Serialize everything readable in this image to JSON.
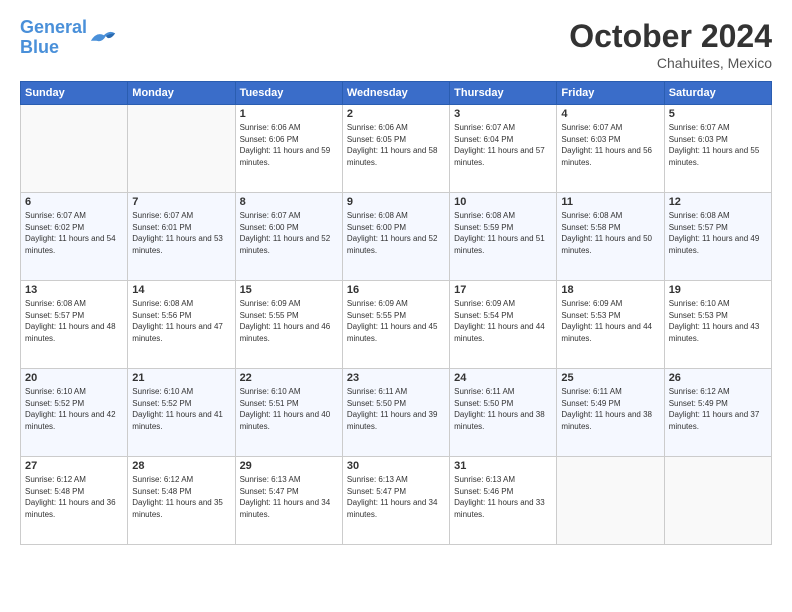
{
  "header": {
    "logo_line1": "General",
    "logo_line2": "Blue",
    "month_title": "October 2024",
    "subtitle": "Chahuites, Mexico"
  },
  "days_of_week": [
    "Sunday",
    "Monday",
    "Tuesday",
    "Wednesday",
    "Thursday",
    "Friday",
    "Saturday"
  ],
  "weeks": [
    [
      {
        "day": "",
        "info": ""
      },
      {
        "day": "",
        "info": ""
      },
      {
        "day": "1",
        "info": "Sunrise: 6:06 AM\nSunset: 6:06 PM\nDaylight: 11 hours and 59 minutes."
      },
      {
        "day": "2",
        "info": "Sunrise: 6:06 AM\nSunset: 6:05 PM\nDaylight: 11 hours and 58 minutes."
      },
      {
        "day": "3",
        "info": "Sunrise: 6:07 AM\nSunset: 6:04 PM\nDaylight: 11 hours and 57 minutes."
      },
      {
        "day": "4",
        "info": "Sunrise: 6:07 AM\nSunset: 6:03 PM\nDaylight: 11 hours and 56 minutes."
      },
      {
        "day": "5",
        "info": "Sunrise: 6:07 AM\nSunset: 6:03 PM\nDaylight: 11 hours and 55 minutes."
      }
    ],
    [
      {
        "day": "6",
        "info": "Sunrise: 6:07 AM\nSunset: 6:02 PM\nDaylight: 11 hours and 54 minutes."
      },
      {
        "day": "7",
        "info": "Sunrise: 6:07 AM\nSunset: 6:01 PM\nDaylight: 11 hours and 53 minutes."
      },
      {
        "day": "8",
        "info": "Sunrise: 6:07 AM\nSunset: 6:00 PM\nDaylight: 11 hours and 52 minutes."
      },
      {
        "day": "9",
        "info": "Sunrise: 6:08 AM\nSunset: 6:00 PM\nDaylight: 11 hours and 52 minutes."
      },
      {
        "day": "10",
        "info": "Sunrise: 6:08 AM\nSunset: 5:59 PM\nDaylight: 11 hours and 51 minutes."
      },
      {
        "day": "11",
        "info": "Sunrise: 6:08 AM\nSunset: 5:58 PM\nDaylight: 11 hours and 50 minutes."
      },
      {
        "day": "12",
        "info": "Sunrise: 6:08 AM\nSunset: 5:57 PM\nDaylight: 11 hours and 49 minutes."
      }
    ],
    [
      {
        "day": "13",
        "info": "Sunrise: 6:08 AM\nSunset: 5:57 PM\nDaylight: 11 hours and 48 minutes."
      },
      {
        "day": "14",
        "info": "Sunrise: 6:08 AM\nSunset: 5:56 PM\nDaylight: 11 hours and 47 minutes."
      },
      {
        "day": "15",
        "info": "Sunrise: 6:09 AM\nSunset: 5:55 PM\nDaylight: 11 hours and 46 minutes."
      },
      {
        "day": "16",
        "info": "Sunrise: 6:09 AM\nSunset: 5:55 PM\nDaylight: 11 hours and 45 minutes."
      },
      {
        "day": "17",
        "info": "Sunrise: 6:09 AM\nSunset: 5:54 PM\nDaylight: 11 hours and 44 minutes."
      },
      {
        "day": "18",
        "info": "Sunrise: 6:09 AM\nSunset: 5:53 PM\nDaylight: 11 hours and 44 minutes."
      },
      {
        "day": "19",
        "info": "Sunrise: 6:10 AM\nSunset: 5:53 PM\nDaylight: 11 hours and 43 minutes."
      }
    ],
    [
      {
        "day": "20",
        "info": "Sunrise: 6:10 AM\nSunset: 5:52 PM\nDaylight: 11 hours and 42 minutes."
      },
      {
        "day": "21",
        "info": "Sunrise: 6:10 AM\nSunset: 5:52 PM\nDaylight: 11 hours and 41 minutes."
      },
      {
        "day": "22",
        "info": "Sunrise: 6:10 AM\nSunset: 5:51 PM\nDaylight: 11 hours and 40 minutes."
      },
      {
        "day": "23",
        "info": "Sunrise: 6:11 AM\nSunset: 5:50 PM\nDaylight: 11 hours and 39 minutes."
      },
      {
        "day": "24",
        "info": "Sunrise: 6:11 AM\nSunset: 5:50 PM\nDaylight: 11 hours and 38 minutes."
      },
      {
        "day": "25",
        "info": "Sunrise: 6:11 AM\nSunset: 5:49 PM\nDaylight: 11 hours and 38 minutes."
      },
      {
        "day": "26",
        "info": "Sunrise: 6:12 AM\nSunset: 5:49 PM\nDaylight: 11 hours and 37 minutes."
      }
    ],
    [
      {
        "day": "27",
        "info": "Sunrise: 6:12 AM\nSunset: 5:48 PM\nDaylight: 11 hours and 36 minutes."
      },
      {
        "day": "28",
        "info": "Sunrise: 6:12 AM\nSunset: 5:48 PM\nDaylight: 11 hours and 35 minutes."
      },
      {
        "day": "29",
        "info": "Sunrise: 6:13 AM\nSunset: 5:47 PM\nDaylight: 11 hours and 34 minutes."
      },
      {
        "day": "30",
        "info": "Sunrise: 6:13 AM\nSunset: 5:47 PM\nDaylight: 11 hours and 34 minutes."
      },
      {
        "day": "31",
        "info": "Sunrise: 6:13 AM\nSunset: 5:46 PM\nDaylight: 11 hours and 33 minutes."
      },
      {
        "day": "",
        "info": ""
      },
      {
        "day": "",
        "info": ""
      }
    ]
  ]
}
